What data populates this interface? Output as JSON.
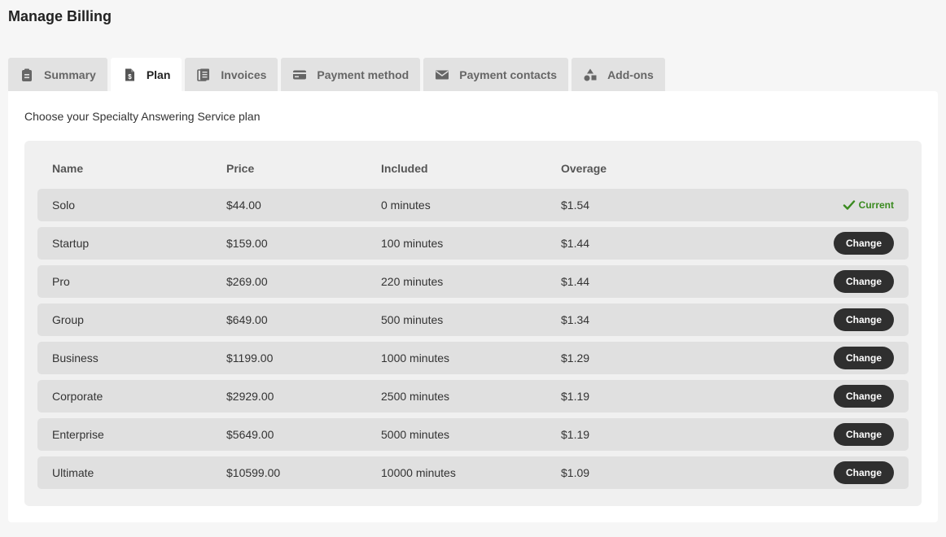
{
  "page": {
    "title": "Manage Billing"
  },
  "tabs": [
    {
      "label": "Summary",
      "icon": "clipboard-icon",
      "active": false
    },
    {
      "label": "Plan",
      "icon": "document-dollar-icon",
      "active": true
    },
    {
      "label": "Invoices",
      "icon": "documents-icon",
      "active": false
    },
    {
      "label": "Payment method",
      "icon": "credit-card-icon",
      "active": false
    },
    {
      "label": "Payment contacts",
      "icon": "envelope-icon",
      "active": false
    },
    {
      "label": "Add-ons",
      "icon": "shapes-icon",
      "active": false
    }
  ],
  "plan": {
    "intro": "Choose your Specialty Answering Service plan",
    "headers": {
      "name": "Name",
      "price": "Price",
      "included": "Included",
      "overage": "Overage"
    },
    "current_label": "Current",
    "change_label": "Change",
    "rows": [
      {
        "name": "Solo",
        "price": "$44.00",
        "included": "0 minutes",
        "overage": "$1.54",
        "current": true
      },
      {
        "name": "Startup",
        "price": "$159.00",
        "included": "100 minutes",
        "overage": "$1.44",
        "current": false
      },
      {
        "name": "Pro",
        "price": "$269.00",
        "included": "220 minutes",
        "overage": "$1.44",
        "current": false
      },
      {
        "name": "Group",
        "price": "$649.00",
        "included": "500 minutes",
        "overage": "$1.34",
        "current": false
      },
      {
        "name": "Business",
        "price": "$1199.00",
        "included": "1000 minutes",
        "overage": "$1.29",
        "current": false
      },
      {
        "name": "Corporate",
        "price": "$2929.00",
        "included": "2500 minutes",
        "overage": "$1.19",
        "current": false
      },
      {
        "name": "Enterprise",
        "price": "$5649.00",
        "included": "5000 minutes",
        "overage": "$1.19",
        "current": false
      },
      {
        "name": "Ultimate",
        "price": "$10599.00",
        "included": "10000 minutes",
        "overage": "$1.09",
        "current": false
      }
    ]
  },
  "colors": {
    "accent_dark": "#2f2f2f",
    "current_green": "#3a8a1f",
    "row_bg": "#e0e0e0"
  }
}
